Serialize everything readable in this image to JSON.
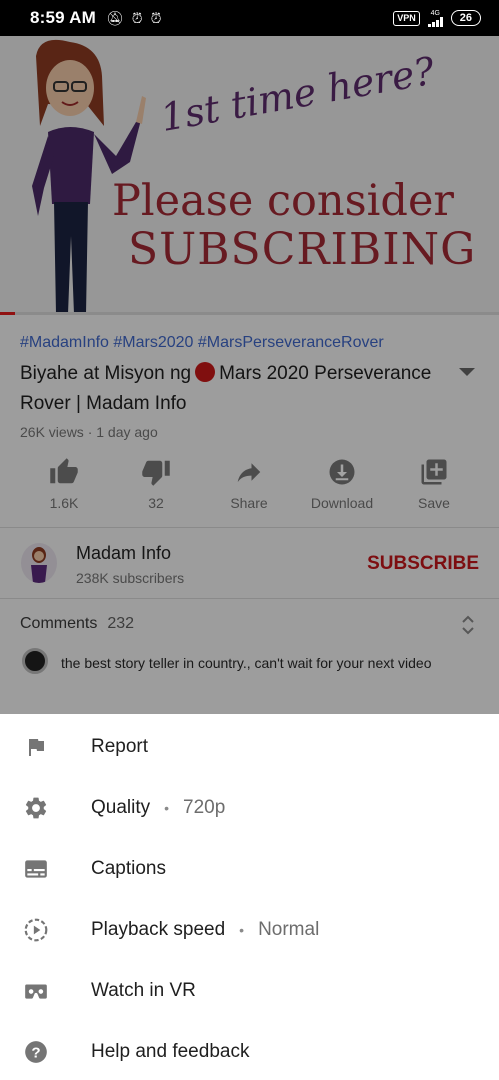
{
  "status_bar": {
    "time": "8:59 AM",
    "vpn": "VPN",
    "network": "4G",
    "battery": "26"
  },
  "thumbnail": {
    "line1": "1st time here?",
    "line2": "Please consider",
    "line3": "SUBSCRIBING"
  },
  "video": {
    "hashtags": "#MadamInfo #Mars2020 #MarsPerseveranceRover",
    "title_part1": "Biyahe at Misyon ng",
    "title_part2": "Mars 2020 Perseverance Rover | Madam Info",
    "meta": "26K views · 1 day ago",
    "progress_fraction": 0.03
  },
  "actions": {
    "like": "1.6K",
    "dislike": "32",
    "share": "Share",
    "download": "Download",
    "save": "Save"
  },
  "channel": {
    "name": "Madam Info",
    "subscribers": "238K subscribers",
    "subscribe_label": "SUBSCRIBE"
  },
  "comments": {
    "label": "Comments",
    "count": "232",
    "top_comment": "the best story teller in country., can't wait for your next video"
  },
  "menu": {
    "items": [
      {
        "label": "Report",
        "icon": "flag-icon"
      },
      {
        "label": "Quality",
        "value": "720p",
        "icon": "gear-icon"
      },
      {
        "label": "Captions",
        "icon": "captions-icon"
      },
      {
        "label": "Playback speed",
        "value": "Normal",
        "icon": "playback-speed-icon"
      },
      {
        "label": "Watch in VR",
        "icon": "vr-headset-icon"
      },
      {
        "label": "Help and feedback",
        "icon": "help-icon"
      }
    ]
  },
  "colors": {
    "accent_red": "#c4171c",
    "hashtag_blue": "#3f67c8"
  }
}
